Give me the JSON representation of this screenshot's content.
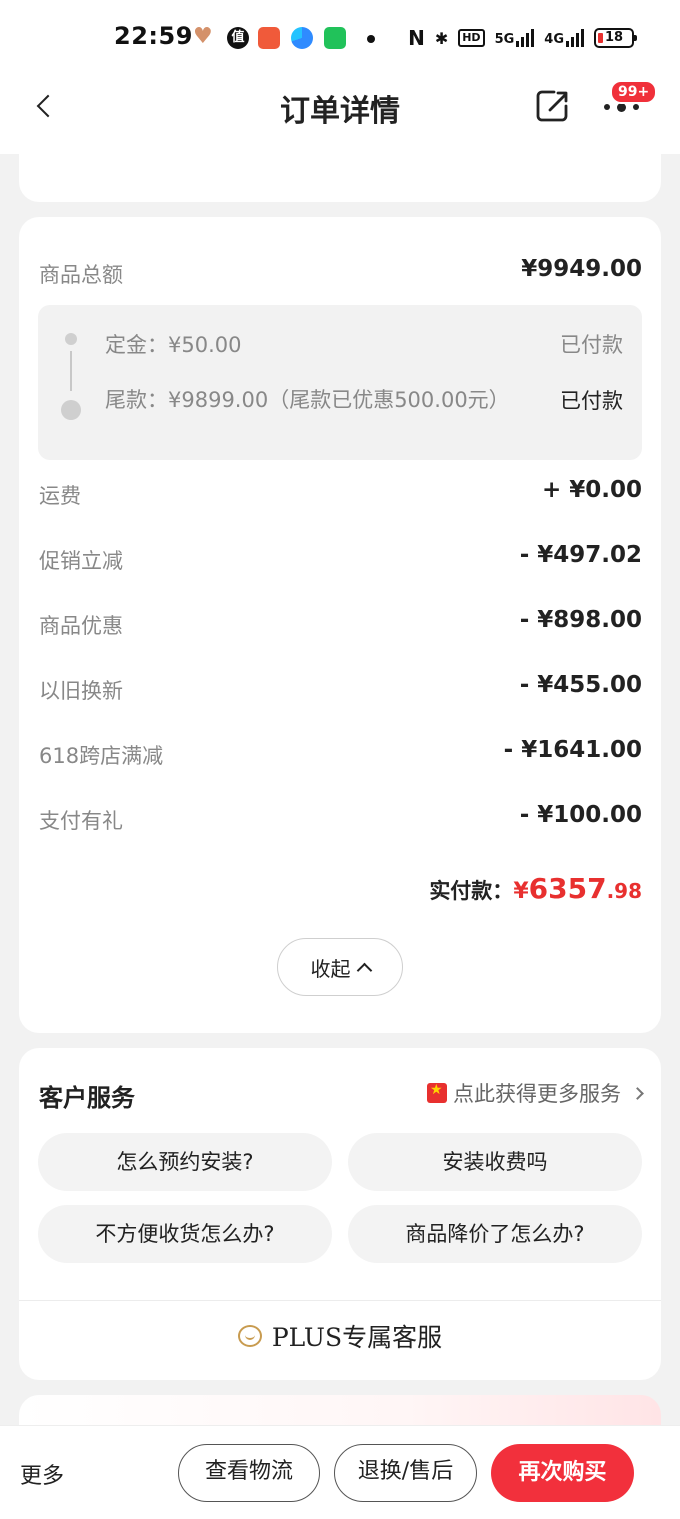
{
  "status_bar": {
    "time": "22:59",
    "battery": "18",
    "net1": "5G",
    "net2": "4G",
    "hd": "HD"
  },
  "header": {
    "title": "订单详情",
    "badge": "99+"
  },
  "price": {
    "total_label": "商品总额",
    "total_value": "¥9949.00",
    "deposit_label": "定金：¥50.00",
    "deposit_status": "已付款",
    "balance_label": "尾款：¥9899.00（尾款已优惠500.00元）",
    "balance_status": "已付款",
    "rows": [
      {
        "label": "运费",
        "value": "+ ¥0.00"
      },
      {
        "label": "促销立减",
        "value": "- ¥497.02"
      },
      {
        "label": "商品优惠",
        "value": "- ¥898.00"
      },
      {
        "label": "以旧换新",
        "value": "- ¥455.00"
      },
      {
        "label": "618跨店满减",
        "value": "- ¥1641.00"
      },
      {
        "label": "支付有礼",
        "value": "- ¥100.00"
      }
    ],
    "actual_label": "实付款：",
    "actual_currency": "¥",
    "actual_int": "6357",
    "actual_dec": ".98",
    "collapse_label": "收起"
  },
  "service": {
    "title": "客户服务",
    "more_label": "点此获得更多服务",
    "questions": [
      "怎么预约安装?",
      "安装收费吗",
      "不方便收货怎么办?",
      "商品降价了怎么办?"
    ],
    "plus_label": "PLUS专属客服"
  },
  "bottom": {
    "more": "更多",
    "logistics": "查看物流",
    "return": "退换/售后",
    "rebuy": "再次购买"
  },
  "colors": {
    "accent": "#f2303c",
    "price_red": "#e8302f",
    "plus_gold": "#c89b4f"
  }
}
